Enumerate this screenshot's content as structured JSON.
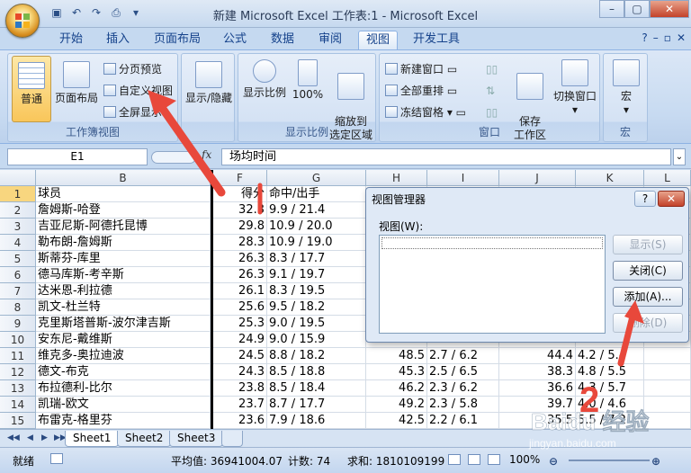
{
  "window": {
    "title": "新建 Microsoft Excel 工作表:1 - Microsoft Excel",
    "qat_icons": [
      "save-icon",
      "undo-icon",
      "redo-icon",
      "print-preview-icon"
    ],
    "buttons": {
      "minimize": "–",
      "maximize": "▢",
      "close": "✕"
    }
  },
  "tabs": [
    "开始",
    "插入",
    "页面布局",
    "公式",
    "数据",
    "审阅",
    "视图",
    "开发工具"
  ],
  "active_tab": "视图",
  "tab_right": {
    "help": "?",
    "min": "–",
    "restore": "▫",
    "close": "✕"
  },
  "ribbon": {
    "workbook_views": {
      "label": "工作簿视图",
      "normal": "普通",
      "page_layout": "页面布局",
      "page_break_preview": "分页预览",
      "custom_views": "自定义视图",
      "full_screen": "全屏显示"
    },
    "show_hide": {
      "label": "",
      "button": "显示/隐藏"
    },
    "zoom": {
      "label": "显示比例",
      "zoom": "显示比例",
      "hundred": "100%",
      "zoom_to_selection": "缩放到\n选定区域"
    },
    "window": {
      "label": "窗口",
      "new_window": "新建窗口",
      "arrange_all": "全部重排",
      "freeze_panes": "冻结窗格",
      "save_workspace": "保存\n工作区",
      "switch_windows": "切换窗口"
    },
    "macros": {
      "label": "宏",
      "button": "宏"
    }
  },
  "formula_bar": {
    "name_box": "E1",
    "fx": "fx",
    "content": "场均时间"
  },
  "grid": {
    "columns": [
      "B",
      "F",
      "G",
      "H",
      "I",
      "J",
      "K",
      "L"
    ],
    "rows": [
      {
        "n": "1",
        "b": "球员",
        "f": "得分",
        "g": "命中/出手",
        "h": "",
        "i": "",
        "j": "",
        "k": ""
      },
      {
        "n": "2",
        "b": "詹姆斯-哈登",
        "f": "32.3",
        "g": "9.9 / 21.4",
        "h": "",
        "i": "",
        "j": "",
        "k": ""
      },
      {
        "n": "3",
        "b": "吉亚尼斯-阿德托昆博",
        "f": "29.8",
        "g": "10.9 / 20.0",
        "h": "",
        "i": "",
        "j": "",
        "k": ""
      },
      {
        "n": "4",
        "b": "勒布朗-詹姆斯",
        "f": "28.3",
        "g": "10.9 / 19.0",
        "h": "",
        "i": "",
        "j": "",
        "k": ""
      },
      {
        "n": "5",
        "b": "斯蒂芬-库里",
        "f": "26.3",
        "g": "8.3 / 17.7",
        "h": "",
        "i": "",
        "j": "",
        "k": ""
      },
      {
        "n": "6",
        "b": "德马库斯-考辛斯",
        "f": "26.3",
        "g": "9.1 / 19.7",
        "h": "",
        "i": "",
        "j": "",
        "k": ""
      },
      {
        "n": "7",
        "b": "达米恩-利拉德",
        "f": "26.1",
        "g": "8.3 / 19.5",
        "h": "",
        "i": "",
        "j": "",
        "k": ""
      },
      {
        "n": "8",
        "b": "凯文-杜兰特",
        "f": "25.6",
        "g": "9.5 / 18.2",
        "h": "",
        "i": "",
        "j": "",
        "k": ""
      },
      {
        "n": "9",
        "b": "克里斯塔普斯-波尔津吉斯",
        "f": "25.3",
        "g": "9.0 / 19.5",
        "h": "",
        "i": "",
        "j": "",
        "k": ""
      },
      {
        "n": "10",
        "b": "安东尼-戴维斯",
        "f": "24.9",
        "g": "9.0 / 15.9",
        "h": "",
        "i": "",
        "j": "",
        "k": ""
      },
      {
        "n": "11",
        "b": "维克多-奥拉迪波",
        "f": "24.5",
        "g": "8.8 / 18.2",
        "h": "48.5",
        "i": "2.7 / 6.2",
        "j": "44.4",
        "k": "4.2 / 5.4"
      },
      {
        "n": "12",
        "b": "德文-布克",
        "f": "24.3",
        "g": "8.5 / 18.8",
        "h": "45.3",
        "i": "2.5 / 6.5",
        "j": "38.3",
        "k": "4.8 / 5.5"
      },
      {
        "n": "13",
        "b": "布拉德利-比尔",
        "f": "23.8",
        "g": "8.5 / 18.4",
        "h": "46.2",
        "i": "2.3 / 6.2",
        "j": "36.6",
        "k": "4.3 / 5.7"
      },
      {
        "n": "14",
        "b": "凯瑞-欧文",
        "f": "23.7",
        "g": "8.7 / 17.7",
        "h": "49.2",
        "i": "2.3 / 5.8",
        "j": "39.7",
        "k": "4.0 / 4.6"
      },
      {
        "n": "15",
        "b": "布雷克-格里芬",
        "f": "23.6",
        "g": "7.9 / 18.6",
        "h": "42.5",
        "i": "2.2 / 6.1",
        "j": "35.5",
        "k": "5.5 / 7.2"
      }
    ]
  },
  "sheets": [
    "Sheet1",
    "Sheet2",
    "Sheet3"
  ],
  "active_sheet": "Sheet1",
  "status": {
    "ready": "就绪",
    "average": "平均值: 36941004.07",
    "count": "计数: 74",
    "sum": "求和: 1810109199",
    "zoom": "100%"
  },
  "dialog": {
    "title": "视图管理器",
    "help": "?",
    "close": "✕",
    "list_label": "视图(W):",
    "buttons": {
      "show": "显示(S)",
      "close": "关闭(C)",
      "add": "添加(A)...",
      "delete": "删除(D)"
    }
  },
  "annotations": {
    "arrow_color": "#e8483b",
    "step_number": "2"
  },
  "watermark": "Baidu 经验 jingyan.baidu.com"
}
